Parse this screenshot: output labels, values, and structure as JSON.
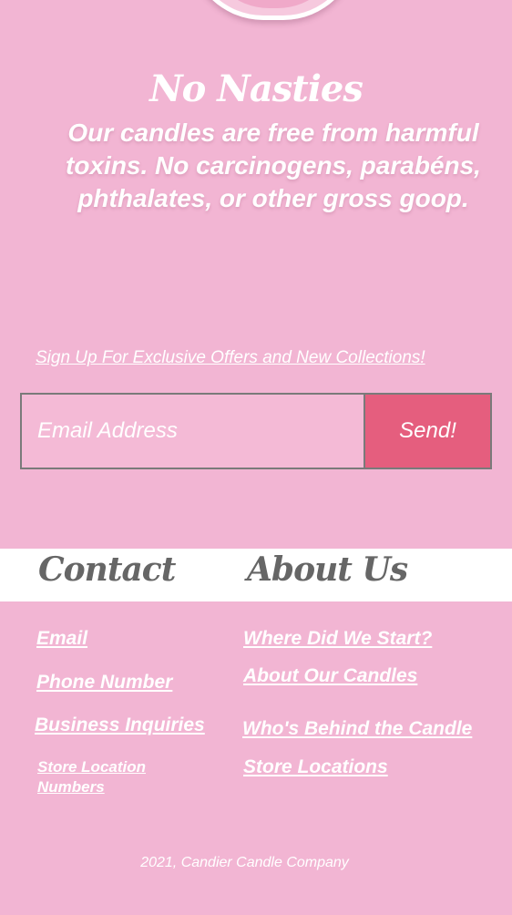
{
  "hero": {
    "title": "No Nasties",
    "body": "Our candles are free from harmful toxins. No carcinogens, parabéns, phthalates, or other gross goop."
  },
  "newsletter": {
    "signup_link": "Sign Up For Exclusive Offers and New Collections! ",
    "email_placeholder": "Email Address",
    "send_label": "Send!"
  },
  "footer": {
    "contact": {
      "heading": "Contact",
      "links": [
        "Email",
        "Phone Number",
        "Business Inquiries",
        "Store Location Numbers"
      ]
    },
    "about": {
      "heading": "About Us",
      "links": [
        "Where Did We Start?",
        "About Our Candles",
        "Who's Behind the Candle",
        "Store Locations"
      ]
    },
    "copyright": "2021, Candier Candle Company"
  },
  "colors": {
    "background": "#f2b5d3",
    "accent_button": "#e55e7e",
    "heading_gray": "#666666",
    "band_white": "#ffffff"
  }
}
